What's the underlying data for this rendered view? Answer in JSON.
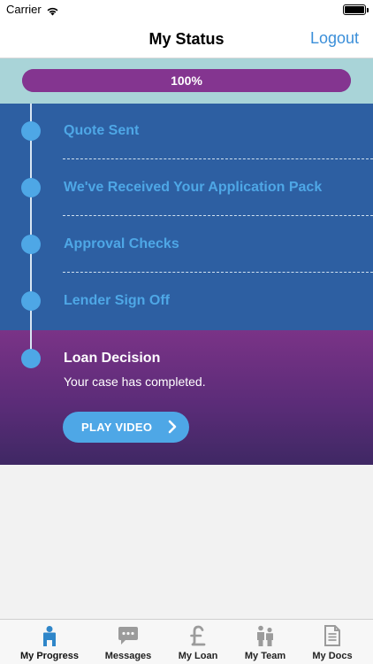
{
  "status_bar": {
    "carrier": "Carrier",
    "time": ""
  },
  "nav": {
    "title": "My Status",
    "action": "Logout"
  },
  "progress": {
    "value": 1.0,
    "label": "100%"
  },
  "steps": [
    {
      "label": "Quote Sent",
      "state": "done"
    },
    {
      "label": "We've Received Your Application Pack",
      "state": "done"
    },
    {
      "label": "Approval Checks",
      "state": "done"
    },
    {
      "label": "Lender Sign Off",
      "state": "done"
    },
    {
      "label": "Loan Decision",
      "state": "active",
      "description": "Your case has completed."
    }
  ],
  "video_button": {
    "label": "PLAY VIDEO",
    "icon": "chevron-right-icon"
  },
  "tabs": [
    {
      "label": "My Progress",
      "icon": "person-icon",
      "selected": true
    },
    {
      "label": "Messages",
      "icon": "chat-bubble-icon",
      "selected": false
    },
    {
      "label": "My Loan",
      "icon": "pound-icon",
      "selected": false
    },
    {
      "label": "My Team",
      "icon": "team-icon",
      "selected": false
    },
    {
      "label": "My Docs",
      "icon": "document-icon",
      "selected": false
    }
  ],
  "colors": {
    "accent": "#4ea7e6",
    "step_background": "#2d5fa2",
    "active_background": "#7a3387",
    "progress_fill": "#843590",
    "link": "#3b8fd9"
  }
}
